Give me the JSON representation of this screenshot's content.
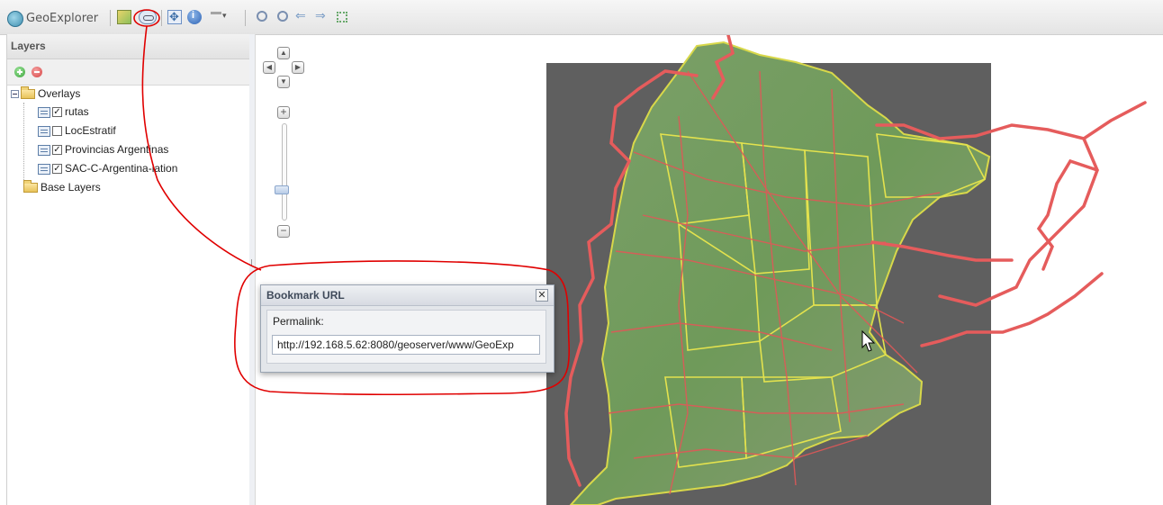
{
  "app": {
    "title": "GeoExplorer"
  },
  "toolbar": {
    "tools": [
      {
        "icon": "layer-switcher-icon"
      },
      {
        "icon": "link-icon",
        "tooltip": "Bookmark URL"
      },
      {
        "icon": "pan-icon"
      },
      {
        "icon": "info-icon"
      },
      {
        "icon": "measure-icon"
      },
      {
        "icon": "zoom-in-icon"
      },
      {
        "icon": "zoom-out-icon"
      },
      {
        "icon": "back-arrow-icon"
      },
      {
        "icon": "forward-arrow-icon"
      },
      {
        "icon": "zoom-full-extent-icon"
      }
    ]
  },
  "layers_panel": {
    "title": "Layers",
    "add_icon": "add-layer-icon",
    "remove_icon": "remove-layer-icon",
    "tree": {
      "overlays": {
        "label": "Overlays",
        "expanded": true,
        "layers": [
          {
            "label": "rutas",
            "checked": true
          },
          {
            "label": "LocEstratif",
            "checked": false
          },
          {
            "label": "Provincias Argentinas",
            "checked": true
          },
          {
            "label": "SAC-C-Argentina-lation",
            "checked": true
          }
        ]
      },
      "base_layers": {
        "label": "Base Layers"
      }
    }
  },
  "dialog": {
    "title": "Bookmark URL",
    "close_glyph": "✕",
    "permalink_label": "Permalink:",
    "permalink_value": "http://192.168.5.62:8080/geoserver/www/GeoExp"
  },
  "colors": {
    "roads": "#e05858",
    "provinces": "#e3e24e",
    "raster_bg": "#5f5f5f",
    "annotation": "#e00000"
  }
}
